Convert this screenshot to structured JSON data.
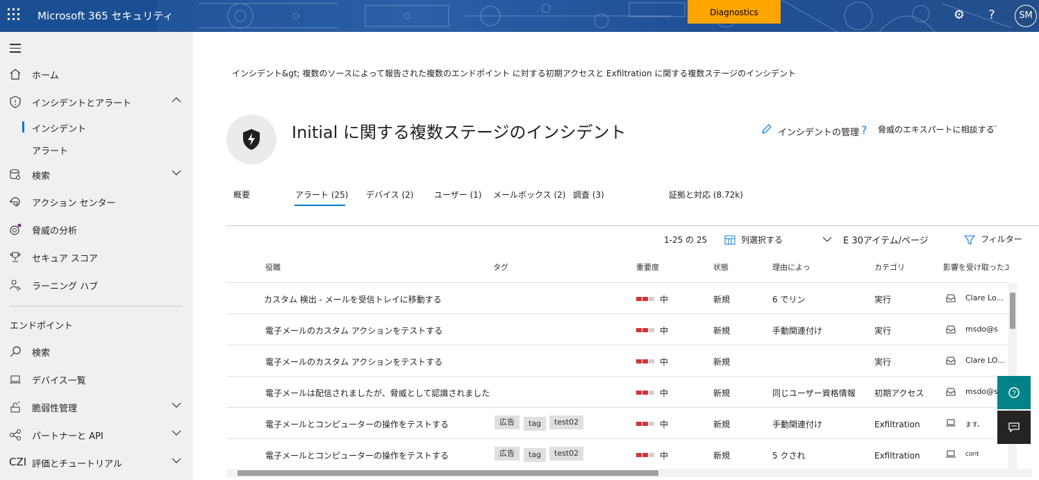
{
  "topbar": {
    "app_title": "Microsoft 365 セキュリティ",
    "diagnostics": "Diagnostics",
    "avatar": "SM",
    "help": "?",
    "settings": "⚙"
  },
  "sidebar": {
    "items": [
      {
        "label": "ホーム",
        "icon": "home-icon"
      },
      {
        "label": "インシデントとアラート",
        "icon": "shield-icon"
      },
      {
        "label": "検索",
        "icon": "hunting-icon"
      },
      {
        "label": "アクション センター",
        "icon": "action-center-icon"
      },
      {
        "label": "脅威の分析",
        "icon": "threat-analytics-icon"
      },
      {
        "label": "セキュア スコア",
        "icon": "trophy-icon"
      },
      {
        "label": "ラーニング ハブ",
        "icon": "learning-hub-icon"
      },
      {
        "label": "検索",
        "icon": "search-icon"
      },
      {
        "label": "デバイス一覧",
        "icon": "laptop-icon"
      },
      {
        "label": "脆弱性管理",
        "icon": "vulnerability-icon"
      },
      {
        "label": "パートナーと API",
        "icon": "partners-icon"
      },
      {
        "label": "評価とチュートリアル",
        "icon": "czi-icon"
      }
    ],
    "sub_incidents": "インシデント",
    "sub_alerts": "アラート",
    "section_endpoint": "エンドポイント",
    "czi": "CZI"
  },
  "breadcrumb": "インシデント&gt;  複数のソースによって報告された複数のエンドポイント に対する初期アクセスと Exfiltration に関する複数ステージのインシデント",
  "page_title": "Initial に関する複数ステージのインシデント",
  "actions": {
    "manage": "インシデントの管理",
    "consult": "脅威のエキスパートに相談する",
    "more": "···"
  },
  "tabs": [
    "概要",
    "アラート (25)",
    "デバイス (2)",
    "ユーザー (1)",
    "メールボックス (2)",
    "調査 (3)",
    "証拠と対応 (8.72k)"
  ],
  "toolbar": {
    "range": "1-25 の 25",
    "choose_columns": "列選択する",
    "per_page": "E 30アイテム/ページ",
    "filter": "フィルター"
  },
  "table": {
    "headers": [
      "役職",
      "タグ",
      "重要度",
      "状態",
      "理由によっ",
      "カテゴリ",
      "影響を受け取ったエンティティ"
    ],
    "rows": [
      {
        "title": "カスタム 検出 - メールを受信トレイに移動する",
        "tags": [],
        "severity": "中",
        "status": "新規",
        "reason": "6 でリン",
        "category": "実行",
        "entity": "Clare Lo..."
      },
      {
        "title": "電子メールのカスタム アクションをテストする",
        "tags": [],
        "severity": "中",
        "status": "新規",
        "reason": "手動関連付け",
        "category": "実行",
        "entity": "msdo@s"
      },
      {
        "title": "電子メールのカスタム アクションをテストする",
        "tags": [],
        "severity": "中",
        "status": "新規",
        "reason": "",
        "category": "実行",
        "entity": "Clare LO..."
      },
      {
        "title": "電子メールは配信されましたが、脅威として認識されました",
        "tags": [],
        "severity": "中",
        "status": "新規",
        "reason": "同じユーザー資格情報",
        "category": "初期アクセス",
        "entity": "msdo@s"
      },
      {
        "title": "電子メールとコンピューターの操作をテストする",
        "tags": [
          "広告",
          "tag",
          "test02"
        ],
        "severity": "中",
        "status": "新規",
        "reason": "手動関連付け",
        "category": "Exfiltration",
        "entity": "ます。"
      },
      {
        "title": "電子メールとコンピューターの操作をテストする",
        "tags": [
          "広告",
          "tag",
          "test02"
        ],
        "severity": "中",
        "status": "新規",
        "reason": "5 クされ",
        "category": "Exfiltration",
        "entity": "cont"
      }
    ]
  },
  "colors": {
    "accent": "#0078d4",
    "severity_red": "#d13438",
    "diagnostics": "#ffa500",
    "help_fab": "#038387"
  }
}
